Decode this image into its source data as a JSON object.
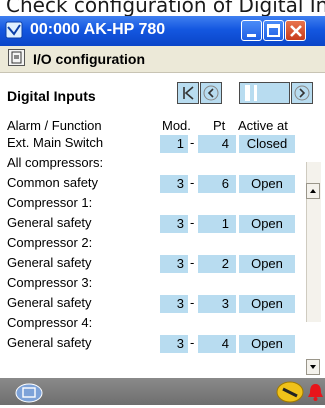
{
  "top_strip": {
    "text": "Check configuration of Digital Inputs"
  },
  "window": {
    "title": "00:000 AK-HP 780",
    "sub_title": "I/O configuration",
    "section_title": "Digital Inputs",
    "colors": {
      "title_blue": "#1457e0",
      "cell_blue": "#b8dcf0"
    }
  },
  "table": {
    "headers": {
      "function": "Alarm / Function",
      "mod": "Mod.",
      "pt": "Pt",
      "active_at": "Active at"
    },
    "rows": [
      {
        "label": "Ext. Main Switch",
        "mod": "1",
        "pt": "4",
        "active": "Closed"
      },
      {
        "label": "All compressors:"
      },
      {
        "label": "Common safety",
        "mod": "3",
        "pt": "6",
        "active": "Open"
      },
      {
        "label": "Compressor 1:"
      },
      {
        "label": "General safety",
        "mod": "3",
        "pt": "1",
        "active": "Open"
      },
      {
        "label": "Compressor 2:"
      },
      {
        "label": "General safety",
        "mod": "3",
        "pt": "2",
        "active": "Open"
      },
      {
        "label": "Compressor 3:"
      },
      {
        "label": "General safety",
        "mod": "3",
        "pt": "3",
        "active": "Open"
      },
      {
        "label": "Compressor 4:"
      },
      {
        "label": "General safety",
        "mod": "3",
        "pt": "4",
        "active": "Open"
      }
    ],
    "dash": "-"
  },
  "icons": [
    "window-icon",
    "minimize-icon",
    "maximize-icon",
    "close-icon",
    "io-config-icon",
    "first-page-icon",
    "prev-page-icon",
    "next-page-icon",
    "scroll-up-icon",
    "scroll-down-icon",
    "home-icon",
    "service-key-icon",
    "alarm-bell-icon"
  ]
}
